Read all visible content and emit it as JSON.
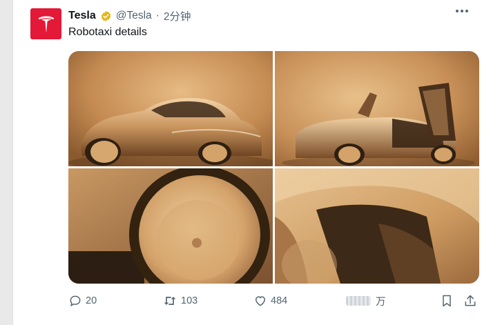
{
  "tweet": {
    "author_name": "Tesla",
    "handle": "@Tesla",
    "separator": "·",
    "time": "2分钟",
    "text": "Robotaxi details",
    "verified_color": "#e2b719",
    "avatar_color": "#e31937"
  },
  "media": {
    "tiles": [
      {
        "icon": "car-front-image"
      },
      {
        "icon": "car-open-doors-image"
      },
      {
        "icon": "wheel-closeup-image"
      },
      {
        "icon": "body-panel-closeup-image"
      }
    ]
  },
  "actions": {
    "replies": "20",
    "retweets": "103",
    "likes": "484",
    "views": "万"
  }
}
